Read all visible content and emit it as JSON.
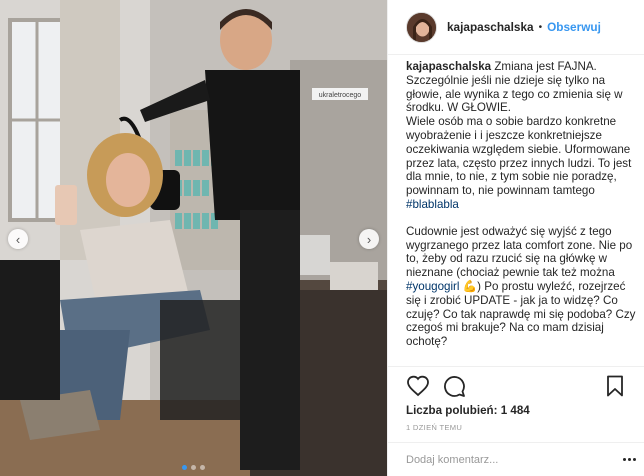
{
  "post": {
    "username": "kajapaschalska",
    "separator": "•",
    "follow_label": "Obserwuj",
    "caption": {
      "user": "kajapaschalska",
      "p1_text": "Zmiana jest FAJNA. Szczególnie jeśli nie dzieje się tylko na głowie, ale wynika z tego co zmienia się w środku. W GŁOWIE.",
      "p2_text": "Wiele osób ma o sobie bardzo konkretne wyobrażenie i i jeszcze konkretniejsze oczekiwania względem siebie. Uformowane przez lata, często przez innych ludzi. To jest dla mnie, to nie, z tym sobie nie poradzę, powinnam to, nie powinnam tamtego",
      "hashtag1": "#blablabla",
      "p3_text": "Cudownie jest odważyć się wyjść z tego wygrzanego przez lata comfort zone. Nie po to, żeby od razu rzucić się na główkę w nieznane (chociaż pewnie tak też można",
      "hashtag2": "#yougogirl",
      "emoji": "💪",
      "p3_tail": ") Po prostu wyleźć, rozejrzeć się i zrobić UPDATE - jak ja to widzę? Co czuję? Co tak naprawdę mi się podoba? Czy czegoś mi brakuje? Na co mam dzisiaj ochotę?"
    },
    "likes_label": "Liczba polubień:",
    "likes_count": "1 484",
    "time_ago": "1 dzień temu",
    "comment_placeholder": "Dodaj komentarz...",
    "carousel": {
      "slides": 3,
      "active": 0,
      "prev_glyph": "‹",
      "next_glyph": "›"
    },
    "photo": {
      "mirror_sign": "ukraletrocego"
    }
  },
  "icons": {
    "like": "heart-icon",
    "comment": "comment-icon",
    "share": "share-icon",
    "save": "bookmark-icon",
    "more": "more-options-icon"
  },
  "colors": {
    "link": "#3897f0",
    "hashtag": "#003569",
    "text": "#262626",
    "muted": "#999999",
    "border": "#efefef"
  }
}
